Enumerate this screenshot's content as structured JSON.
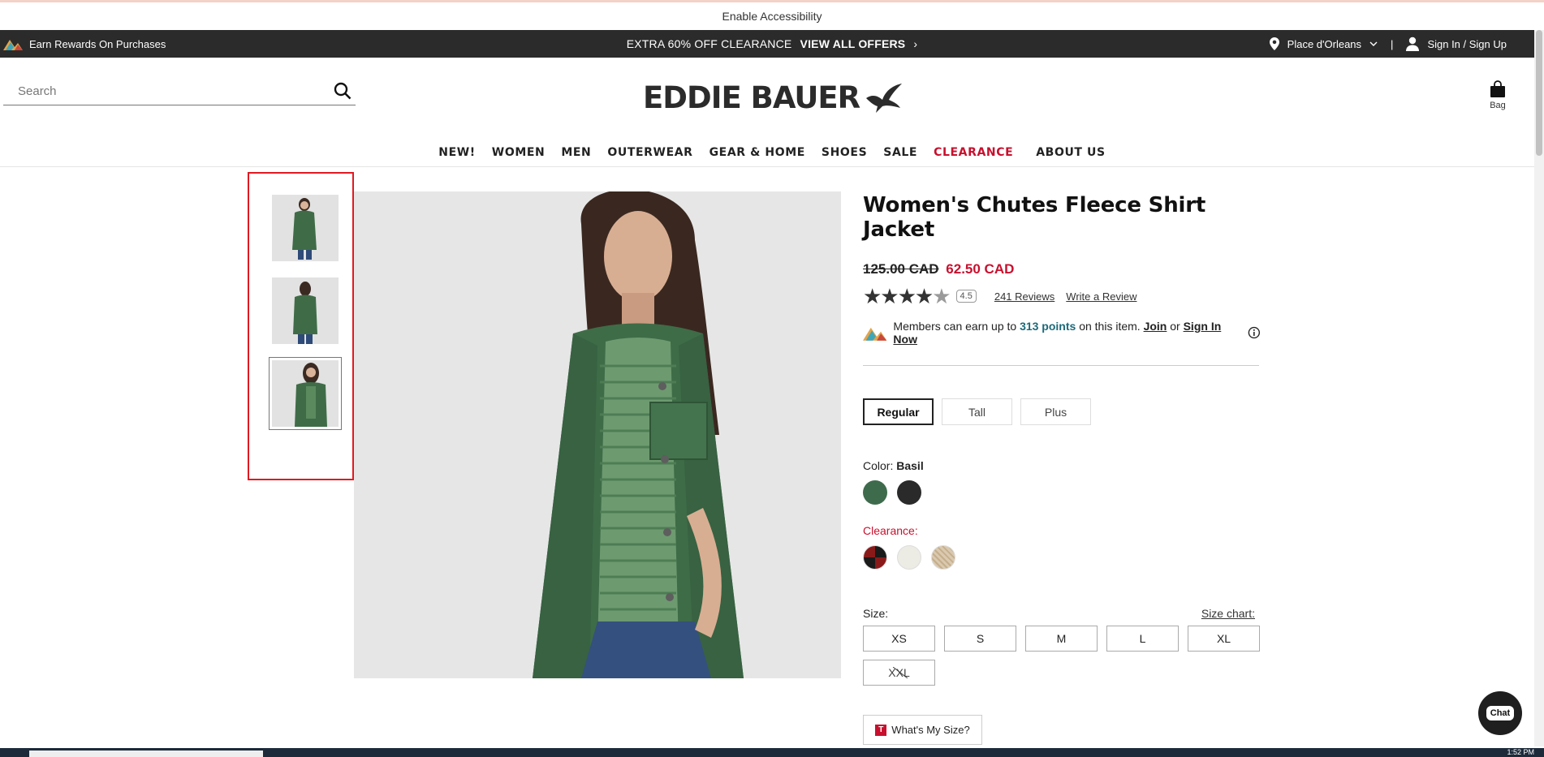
{
  "accessibility": {
    "label": "Enable Accessibility"
  },
  "promo": {
    "rewards": "Earn Rewards On Purchases",
    "center": "EXTRA 60% OFF CLEARANCE",
    "offers": "VIEW ALL OFFERS",
    "location": "Place d'Orleans",
    "separator": "|",
    "signin": "Sign In / Sign Up"
  },
  "header": {
    "search_placeholder": "Search",
    "logo": "EDDIE BAUER",
    "bag": "Bag"
  },
  "nav": [
    {
      "label": "NEW!",
      "style": "normal"
    },
    {
      "label": "WOMEN",
      "style": "normal"
    },
    {
      "label": "MEN",
      "style": "normal"
    },
    {
      "label": "OUTERWEAR",
      "style": "normal"
    },
    {
      "label": "GEAR & HOME",
      "style": "normal"
    },
    {
      "label": "SHOES",
      "style": "normal"
    },
    {
      "label": "SALE",
      "style": "normal"
    },
    {
      "label": "CLEARANCE",
      "style": "clearance"
    },
    {
      "label": "ABOUT US",
      "style": "normal"
    }
  ],
  "product": {
    "title": "Women's Chutes Fleece Shirt Jacket",
    "price_old": "125.00 CAD",
    "price_new": "62.50 CAD",
    "rating": "4.5",
    "reviews": "241 Reviews",
    "write_review": "Write a Review",
    "members_text_1": "Members can earn up to",
    "members_points": "313 points",
    "members_text_2": "on this item.",
    "join": "Join",
    "or": "or",
    "sign_in_now": "Sign In Now",
    "fits": [
      {
        "label": "Regular",
        "selected": true
      },
      {
        "label": "Tall",
        "selected": false
      },
      {
        "label": "Plus",
        "selected": false
      }
    ],
    "color_label": "Color:",
    "color_value": "Basil",
    "colors": [
      "#3e6b4c",
      "#2a2a2a"
    ],
    "clearance_label": "Clearance:",
    "clearance_colors": [
      "#8a1a1a",
      "#ecebe4",
      "#d9c9b0"
    ],
    "size_label": "Size:",
    "size_chart": "Size chart:",
    "sizes": [
      {
        "label": "XS",
        "available": true
      },
      {
        "label": "S",
        "available": true
      },
      {
        "label": "M",
        "available": true
      },
      {
        "label": "L",
        "available": true
      },
      {
        "label": "XL",
        "available": true
      },
      {
        "label": "XXL",
        "available": false
      }
    ],
    "whats_my_size": "What's My Size?"
  },
  "chat": {
    "label": "Chat"
  },
  "taskbar": {
    "time": "1:52 PM"
  }
}
